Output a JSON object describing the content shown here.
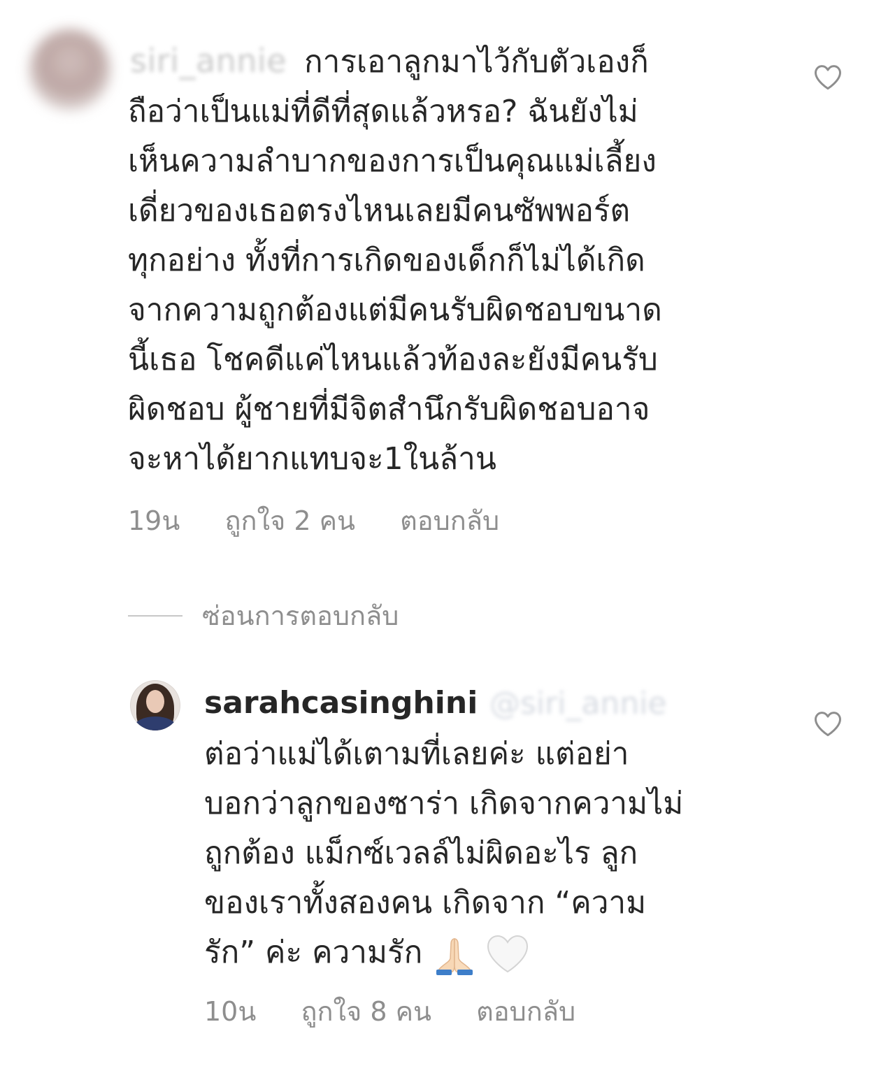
{
  "comments": [
    {
      "avatar_icon": "blurred-avatar",
      "username_blurred": "siri_annie",
      "text_lines": [
        "การเอาลูกมาไว้กับตัวเองก็",
        "ถือว่าเป็นแม่ที่ดีที่สุดแล้วหรอ? ฉันยังไม่",
        "เห็นความลำบากของการเป็นคุณแม่เลี้ยง",
        "เดี่ยวของเธอตรงไหนเลยมีคนซัพพอร์ต",
        "ทุกอย่าง ทั้งที่การเกิดของเด็กก็ไม่ได้เกิด",
        "จากความถูกต้องแต่มีคนรับผิดชอบขนาด",
        "นี้เธอ โชคดีแค่ไหนแล้วท้องละยังมีคนรับ",
        "ผิดชอบ ผู้ชายที่มีจิตสำนึกรับผิดชอบอาจ",
        "จะหาได้ยากแทบจะ1ในล้าน"
      ],
      "time": "19น",
      "likes": "ถูกใจ 2 คน",
      "reply_label": "ตอบกลับ"
    },
    {
      "avatar_icon": "profile-photo",
      "username": "sarahcasinghini",
      "mention_blurred": "@siri_annie",
      "text_lines": [
        "ต่อว่าแม่ได้เตามที่เลยค่ะ แต่อย่า",
        "บอกว่าลูกของซาร่า เกิดจากความไม่",
        "ถูกต้อง แม็กซ์เวลล์ไม่ผิดอะไร ลูก",
        "ของเราทั้งสองคน เกิดจาก “ความ",
        "รัก” ค่ะ ความรัก"
      ],
      "emojis": [
        "folded-hands-emoji",
        "white-heart-emoji"
      ],
      "time": "10น",
      "likes": "ถูกใจ 8 คน",
      "reply_label": "ตอบกลับ"
    }
  ],
  "hide_replies_label": "ซ่อนการตอบกลับ",
  "colors": {
    "text": "#262626",
    "meta": "#8e8e8e",
    "divider": "#c7c7c7",
    "heart_outline": "#8e8e8e"
  }
}
